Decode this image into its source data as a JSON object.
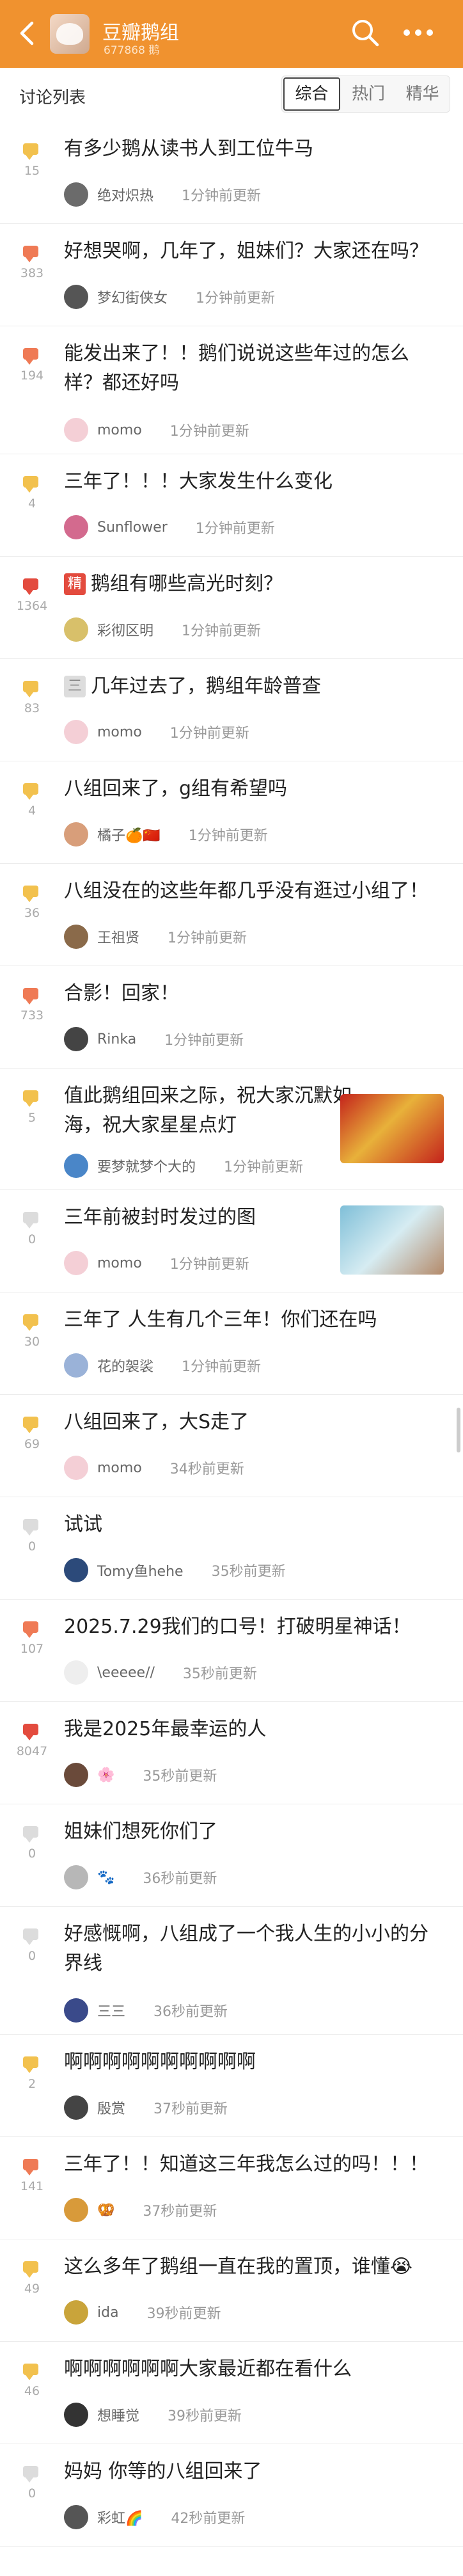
{
  "header": {
    "group_name": "豆瓣鹅组",
    "member_count": "677868 鹅",
    "bg_color": "#f0922f"
  },
  "subbar": {
    "title": "讨论列表",
    "tabs": [
      "综合",
      "热门",
      "精华"
    ],
    "active_tab": 0
  },
  "posts": [
    {
      "count": "15",
      "badge_color": "#f2c14e",
      "title": "有多少鹅从读书人到工位牛马",
      "author": "绝对炽热",
      "time": "1分钟前更新"
    },
    {
      "count": "383",
      "badge_color": "#ef7a55",
      "title": "好想哭啊，几年了，姐妹们？大家还在吗？",
      "author": "梦幻街侠女",
      "time": "1分钟前更新"
    },
    {
      "count": "194",
      "badge_color": "#ef7a55",
      "title": "能发出来了！！鹅们说说这些年过的怎么样？都还好吗",
      "author": "momo",
      "time": "1分钟前更新"
    },
    {
      "count": "4",
      "badge_color": "#f2c14e",
      "title": "三年了！！！大家发生什么变化",
      "author": "Sunflower",
      "time": "1分钟前更新"
    },
    {
      "count": "1364",
      "badge_color": "#e34b3e",
      "tag": "精",
      "title": "鹅组有哪些高光时刻？",
      "author": "彩彻区明",
      "time": "1分钟前更新"
    },
    {
      "count": "83",
      "badge_color": "#f2c14e",
      "tag": "三",
      "title": "几年过去了，鹅组年龄普查",
      "author": "momo",
      "time": "1分钟前更新"
    },
    {
      "count": "4",
      "badge_color": "#f2c14e",
      "title": "八组回来了，g组有希望吗",
      "author": "橘子🍊🇨🇳",
      "time": "1分钟前更新"
    },
    {
      "count": "36",
      "badge_color": "#f2c14e",
      "title": "八组没在的这些年都几乎没有逛过小组了！",
      "author": "王祖贤",
      "time": "1分钟前更新"
    },
    {
      "count": "733",
      "badge_color": "#ef7a55",
      "title": "合影！回家！",
      "author": "Rinka",
      "time": "1分钟前更新"
    },
    {
      "count": "5",
      "badge_color": "#f2c14e",
      "title": "值此鹅组回来之际，祝大家沉默如海，祝大家星星点灯",
      "author": "要梦就梦个大的",
      "time": "1分钟前更新",
      "thumb": "festive-picture"
    },
    {
      "count": "0",
      "badge_color": "#dcdcdc",
      "title": "三年前被封时发过的图",
      "author": "momo",
      "time": "1分钟前更新",
      "thumb": "anime-picture"
    },
    {
      "count": "30",
      "badge_color": "#f2c14e",
      "title": "三年了 人生有几个三年！你们还在吗",
      "author": "花的袈裟",
      "time": "1分钟前更新"
    },
    {
      "count": "69",
      "badge_color": "#f2c14e",
      "title": "八组回来了，大S走了",
      "author": "momo",
      "time": "34秒前更新"
    },
    {
      "count": "0",
      "badge_color": "#dcdcdc",
      "title": "试试",
      "author": "Tomy鱼hehe",
      "time": "35秒前更新"
    },
    {
      "count": "107",
      "badge_color": "#ef7a55",
      "title": "2025.7.29我们的口号！打破明星神话！",
      "author": "\\eeeee//",
      "time": "35秒前更新"
    },
    {
      "count": "8047",
      "badge_color": "#e34b3e",
      "title": "我是2025年最幸运的人",
      "author": "🌸",
      "time": "35秒前更新"
    },
    {
      "count": "0",
      "badge_color": "#dcdcdc",
      "title": "姐妹们想死你们了",
      "author": "🐾",
      "time": "36秒前更新"
    },
    {
      "count": "0",
      "badge_color": "#dcdcdc",
      "title": "好感慨啊，八组成了一个我人生的小小的分界线",
      "author": "三三",
      "time": "36秒前更新"
    },
    {
      "count": "2",
      "badge_color": "#f2c14e",
      "title": "啊啊啊啊啊啊啊啊啊啊",
      "author": "殷赏",
      "time": "37秒前更新"
    },
    {
      "count": "141",
      "badge_color": "#ef7a55",
      "title": "三年了！！知道这三年我怎么过的吗！！！",
      "author": "🥨",
      "time": "37秒前更新"
    },
    {
      "count": "49",
      "badge_color": "#f2c14e",
      "title": "这么多年了鹅组一直在我的置顶，谁懂😭",
      "author": "ida",
      "time": "39秒前更新"
    },
    {
      "count": "46",
      "badge_color": "#f2c14e",
      "title": "啊啊啊啊啊啊大家最近都在看什么",
      "author": "想睡觉",
      "time": "39秒前更新"
    },
    {
      "count": "0",
      "badge_color": "#dcdcdc",
      "title": "妈妈 你等的八组回来了",
      "author": "彩虹🌈",
      "time": "42秒前更新"
    }
  ]
}
